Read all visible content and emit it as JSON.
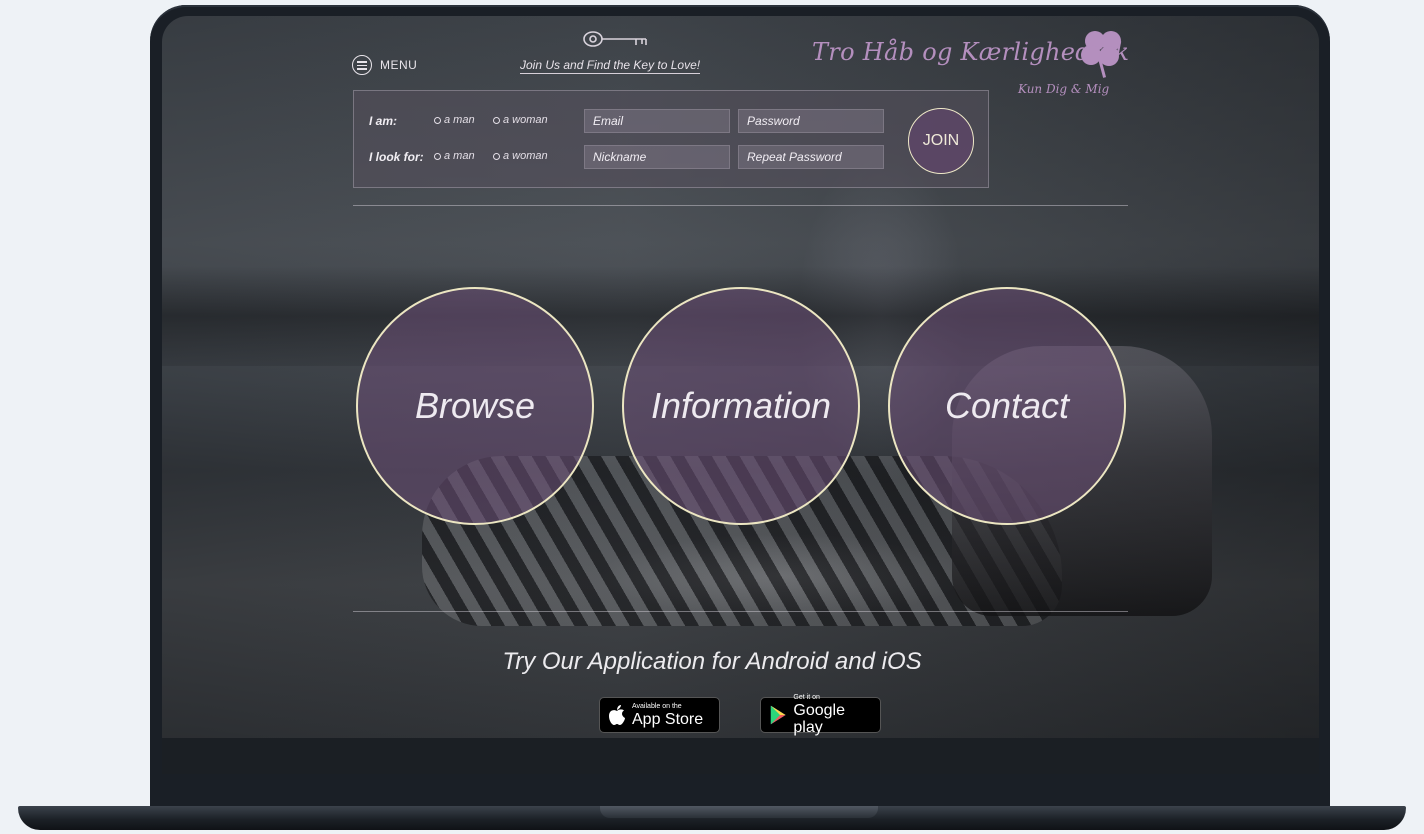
{
  "header": {
    "menu_label": "MENU",
    "tagline": "Join Us and Find the Key to Love!",
    "logo_title": "Tro Håb og Kærlighed.dk",
    "logo_subtitle": "Kun Dig & Mig"
  },
  "signup": {
    "iam_label": "I am:",
    "ilookfor_label": "I look for:",
    "option_man": "a man",
    "option_woman": "a woman",
    "email_placeholder": "Email",
    "password_placeholder": "Password",
    "nickname_placeholder": "Nickname",
    "repeat_password_placeholder": "Repeat Password",
    "join_label": "JOIN"
  },
  "nav_circles": [
    {
      "label": "Browse"
    },
    {
      "label": "Information"
    },
    {
      "label": "Contact"
    }
  ],
  "apps": {
    "heading": "Try Our Application for Android and iOS",
    "appstore_small": "Available on the",
    "appstore_big": "App Store",
    "googleplay_small": "Get it on",
    "googleplay_big": "Google play"
  },
  "colors": {
    "accent_purple": "#b48fbe",
    "circle_border": "#ece6c2",
    "circle_fill": "#6e5078"
  },
  "icons": [
    "menu-icon",
    "key-icon",
    "clover-icon",
    "apple-icon",
    "google-play-icon"
  ]
}
